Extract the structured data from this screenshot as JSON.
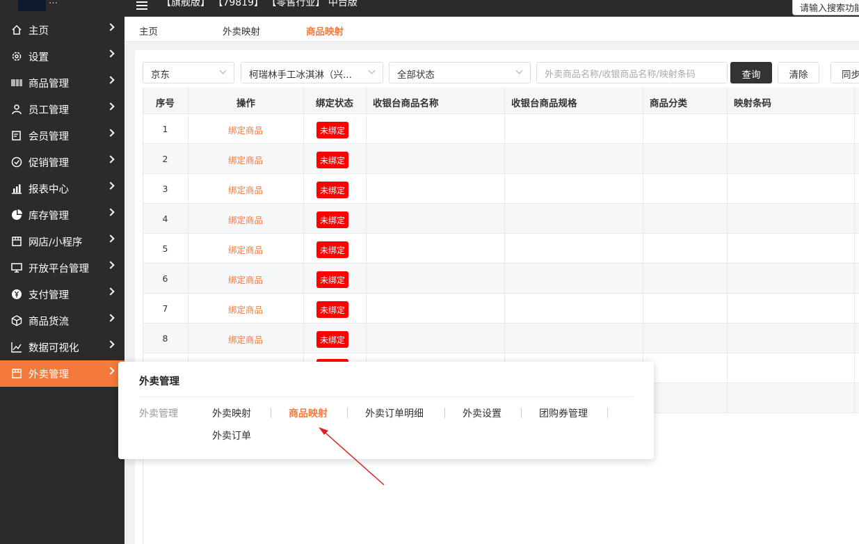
{
  "topbar": {
    "brand": "…",
    "crumbs": "【旗舰版】 【79819】 【零售行业】 中台版",
    "search_text": "请输入搜索功能"
  },
  "sidebar": {
    "items": [
      {
        "label": "主页",
        "icon": "home-icon"
      },
      {
        "label": "设置",
        "icon": "gear-icon"
      },
      {
        "label": "商品管理",
        "icon": "barcode-icon"
      },
      {
        "label": "员工管理",
        "icon": "user-icon"
      },
      {
        "label": "会员管理",
        "icon": "member-card-icon"
      },
      {
        "label": "促销管理",
        "icon": "check-circle-icon"
      },
      {
        "label": "报表中心",
        "icon": "bar-chart-icon"
      },
      {
        "label": "库存管理",
        "icon": "pie-chart-icon"
      },
      {
        "label": "网店/小程序",
        "icon": "shop-icon"
      },
      {
        "label": "开放平台管理",
        "icon": "monitor-icon"
      },
      {
        "label": "支付管理",
        "icon": "yuan-icon"
      },
      {
        "label": "商品货流",
        "icon": "box-icon"
      },
      {
        "label": "数据可视化",
        "icon": "line-chart-icon"
      },
      {
        "label": "外卖管理",
        "icon": "shop-icon",
        "active": true
      }
    ]
  },
  "tabs": [
    "主页",
    "外卖映射",
    "商品映射"
  ],
  "filters": {
    "platform": "京东",
    "store": "柯瑞林手工冰淇淋（兴...",
    "status": "全部状态",
    "search_placeholder": "外卖商品名称/收银商品名称/映射条码"
  },
  "buttons": {
    "query": "查询",
    "clear": "清除",
    "sync": "同步"
  },
  "table": {
    "headers": [
      "序号",
      "操作",
      "绑定状态",
      "收银台商品名称",
      "收银台商品规格",
      "商品分类",
      "映射条码"
    ],
    "rows": [
      {
        "no": "1",
        "op": "绑定商品",
        "status": "未绑定"
      },
      {
        "no": "2",
        "op": "绑定商品",
        "status": "未绑定"
      },
      {
        "no": "3",
        "op": "绑定商品",
        "status": "未绑定"
      },
      {
        "no": "4",
        "op": "绑定商品",
        "status": "未绑定"
      },
      {
        "no": "5",
        "op": "绑定商品",
        "status": "未绑定"
      },
      {
        "no": "6",
        "op": "绑定商品",
        "status": "未绑定"
      },
      {
        "no": "7",
        "op": "绑定商品",
        "status": "未绑定"
      },
      {
        "no": "8",
        "op": "绑定商品",
        "status": "未绑定"
      }
    ]
  },
  "popup": {
    "title": "外卖管理",
    "category": "外卖管理",
    "links": [
      "外卖映射",
      "商品映射",
      "外卖订单明细",
      "外卖设置",
      "团购券管理",
      "外卖订单"
    ]
  },
  "colors": {
    "accent": "#f4793c",
    "sidebar_bg": "#2b2b2b",
    "badge_red": "#ff0000"
  }
}
